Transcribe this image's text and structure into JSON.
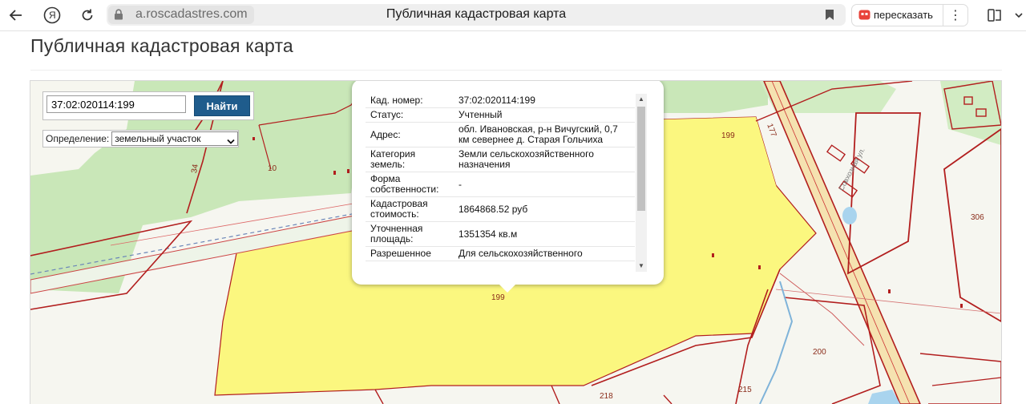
{
  "browser": {
    "url": "a.roscadastres.com",
    "tab_title": "Публичная кадастровая карта",
    "retell_label": "пересказать",
    "yandex_label": "Я"
  },
  "page": {
    "title": "Публичная кадастровая карта"
  },
  "search": {
    "value": "37:02:020114:199",
    "button_label": "Найти"
  },
  "definition": {
    "label": "Определение:",
    "selected": "земельный участок"
  },
  "popup": {
    "rows": [
      {
        "key": "Кад. номер:",
        "value": "37:02:020114:199"
      },
      {
        "key": "Статус:",
        "value": "Учтенный"
      },
      {
        "key": "Адрес:",
        "value": "обл. Ивановская, р-н Вичугский, 0,7 км севернее д. Старая Гольчиха"
      },
      {
        "key": "Категория земель:",
        "value": "Земли сельскохозяйственного назначения"
      },
      {
        "key": "Форма собственности:",
        "value": "-"
      },
      {
        "key": "Кадастровая стоимость:",
        "value": "1864868.52 руб"
      },
      {
        "key": "Уточненная площадь:",
        "value": "1351354 кв.м"
      },
      {
        "key": "Разрешенное",
        "value": "Для сельскохозяйственного"
      }
    ]
  },
  "map": {
    "labels": {
      "l199a": "199",
      "l199b": "199",
      "l10": "10",
      "l34": "34",
      "l177": "177",
      "l306": "306",
      "l200": "200",
      "l218": "218",
      "l215": "215",
      "street": "Совхозная ул."
    },
    "colors": {
      "parcel_fill": "#fbf77f",
      "forest": "#c6e6b5",
      "boundary": "#b21e1e",
      "road": "#f3dfa8",
      "search_button": "#1f5c8c"
    }
  }
}
